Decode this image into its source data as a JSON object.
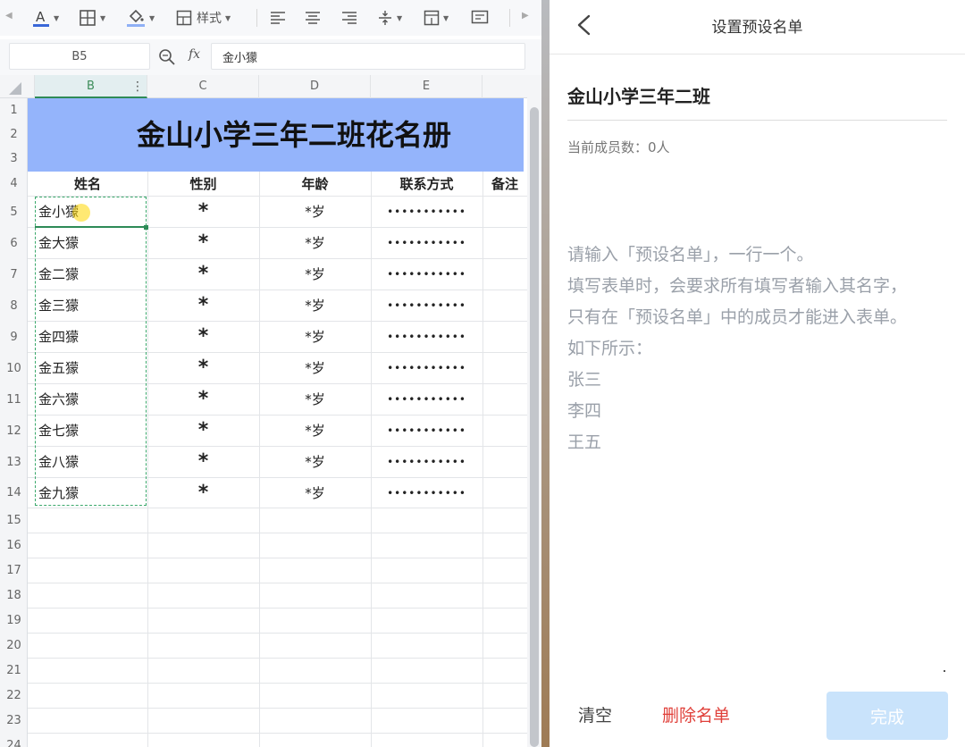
{
  "spreadsheet": {
    "formula_bar": {
      "cell_ref": "B5",
      "fx_label": "fx",
      "value": "金小獴"
    },
    "toolbar": {
      "style_label": "样式"
    },
    "columns": [
      "B",
      "C",
      "D",
      "E"
    ],
    "rows": [
      "1",
      "2",
      "3",
      "4",
      "5",
      "6",
      "7",
      "8",
      "9",
      "10",
      "11",
      "12",
      "13",
      "14",
      "15",
      "16",
      "17",
      "18",
      "19",
      "20",
      "21",
      "22",
      "23",
      "24"
    ],
    "title": "金山小学三年二班花名册",
    "headers": {
      "name": "姓名",
      "gender": "性别",
      "age": "年龄",
      "contact": "联系方式",
      "note": "备注"
    },
    "records": [
      {
        "name": "金小獴",
        "gender": "*",
        "age": "*岁",
        "contact": "•••••••••••"
      },
      {
        "name": "金大獴",
        "gender": "*",
        "age": "*岁",
        "contact": "•••••••••••"
      },
      {
        "name": "金二獴",
        "gender": "*",
        "age": "*岁",
        "contact": "•••••••••••"
      },
      {
        "name": "金三獴",
        "gender": "*",
        "age": "*岁",
        "contact": "•••••••••••"
      },
      {
        "name": "金四獴",
        "gender": "*",
        "age": "*岁",
        "contact": "•••••••••••"
      },
      {
        "name": "金五獴",
        "gender": "*",
        "age": "*岁",
        "contact": "•••••••••••"
      },
      {
        "name": "金六獴",
        "gender": "*",
        "age": "*岁",
        "contact": "•••••••••••"
      },
      {
        "name": "金七獴",
        "gender": "*",
        "age": "*岁",
        "contact": "•••••••••••"
      },
      {
        "name": "金八獴",
        "gender": "*",
        "age": "*岁",
        "contact": "•••••••••••"
      },
      {
        "name": "金九獴",
        "gender": "*",
        "age": "*岁",
        "contact": "•••••••••••"
      }
    ],
    "colors": {
      "title_band": "#94b4fb",
      "selection": "#2e8b57"
    }
  },
  "roster_panel": {
    "title": "设置预设名单",
    "group_name": "金山小学三年二班",
    "member_count": "当前成员数：0人",
    "placeholder": "请输入「预设名单」，一行一个。\n填写表单时，会要求所有填写者输入其名字，\n只有在「预设名单」中的成员才能进入表单。\n如下所示：\n张三\n李四\n王五",
    "placeholder_lines": [
      "请输入「预设名单」，一行一个。",
      "填写表单时，会要求所有填写者输入其名字，",
      "只有在「预设名单」中的成员才能进入表单。",
      "如下所示：",
      "张三",
      "李四",
      "王五"
    ],
    "clear_label": "清空",
    "delete_label": "删除名单",
    "done_label": "完成",
    "colors": {
      "delete": "#e0403a",
      "done_disabled": "#c9e3fb"
    }
  }
}
